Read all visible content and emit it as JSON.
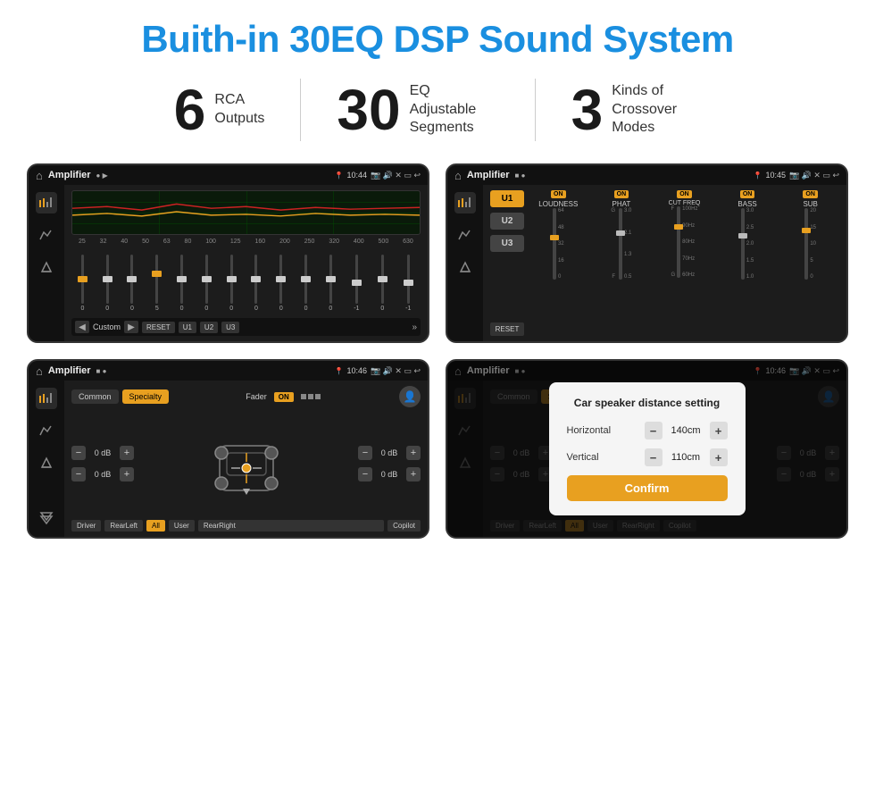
{
  "page": {
    "title": "Buith-in 30EQ DSP Sound System",
    "stats": [
      {
        "number": "6",
        "text": "RCA\nOutputs"
      },
      {
        "number": "30",
        "text": "EQ Adjustable\nSegments"
      },
      {
        "number": "3",
        "text": "Kinds of\nCrossover Modes"
      }
    ],
    "screens": [
      {
        "id": "eq-screen",
        "status_time": "10:44",
        "app_title": "Amplifier",
        "type": "eq",
        "preset": "Custom",
        "buttons": [
          "RESET",
          "U1",
          "U2",
          "U3"
        ],
        "frequencies": [
          "25",
          "32",
          "40",
          "50",
          "63",
          "80",
          "100",
          "125",
          "160",
          "200",
          "250",
          "320",
          "400",
          "500",
          "630"
        ],
        "slider_values": [
          "0",
          "0",
          "0",
          "5",
          "0",
          "0",
          "0",
          "0",
          "0",
          "0",
          "0",
          "-1",
          "0",
          "-1"
        ]
      },
      {
        "id": "crossover-screen",
        "status_time": "10:45",
        "app_title": "Amplifier",
        "type": "crossover",
        "u_buttons": [
          "U1",
          "U2",
          "U3"
        ],
        "channels": [
          {
            "label": "LOUDNESS",
            "on": true
          },
          {
            "label": "PHAT",
            "on": true
          },
          {
            "label": "CUT FREQ",
            "on": true
          },
          {
            "label": "BASS",
            "on": true
          },
          {
            "label": "SUB",
            "on": true
          }
        ]
      },
      {
        "id": "fader-screen",
        "status_time": "10:46",
        "app_title": "Amplifier",
        "type": "fader",
        "tabs": [
          "Common",
          "Specialty"
        ],
        "active_tab": "Specialty",
        "fader_label": "Fader",
        "fader_on": true,
        "volumes": [
          "0 dB",
          "0 dB",
          "0 dB",
          "0 dB"
        ],
        "buttons": [
          "Driver",
          "RearLeft",
          "All",
          "User",
          "RearRight",
          "Copilot"
        ]
      },
      {
        "id": "dialog-screen",
        "status_time": "10:46",
        "app_title": "Amplifier",
        "type": "dialog",
        "dialog": {
          "title": "Car speaker distance setting",
          "horizontal_label": "Horizontal",
          "horizontal_value": "140cm",
          "vertical_label": "Vertical",
          "vertical_value": "110cm",
          "confirm_label": "Confirm"
        },
        "tabs": [
          "Common",
          "Specialty"
        ],
        "buttons": [
          "Driver",
          "RearLeft",
          "All",
          "User",
          "RearRight",
          "Copilot"
        ]
      }
    ]
  }
}
